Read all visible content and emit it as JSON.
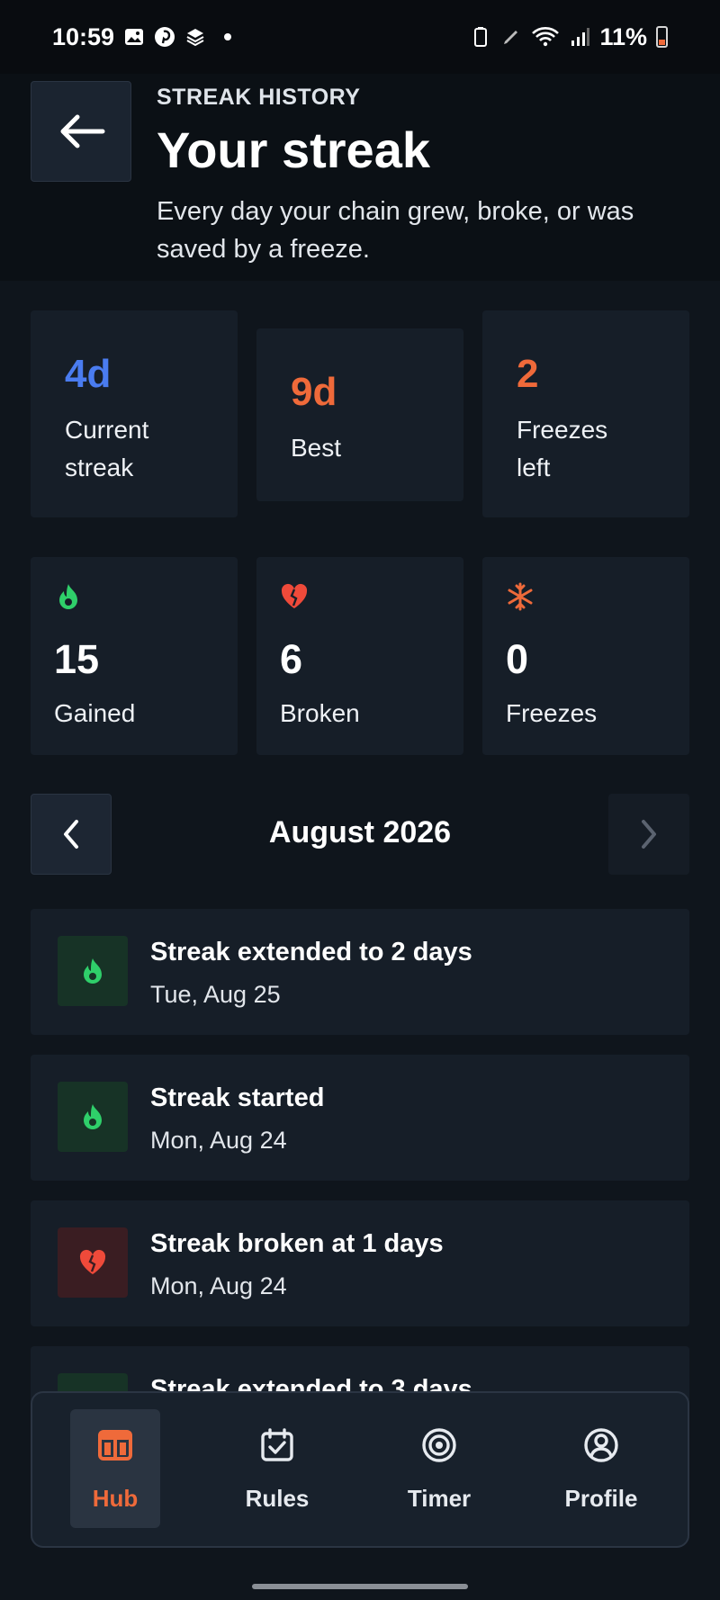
{
  "status_bar": {
    "time": "10:59",
    "battery": "11%"
  },
  "header": {
    "eyebrow": "STREAK HISTORY",
    "title": "Your streak",
    "subtitle": "Every day your chain grew, broke, or was saved by a freeze."
  },
  "stats": [
    {
      "value": "4d",
      "label": "Current streak",
      "color": "#4a7cf0"
    },
    {
      "value": "9d",
      "label": "Best",
      "color": "#ef6a3a"
    },
    {
      "value": "2",
      "label": "Freezes left",
      "color": "#ef6a3a"
    }
  ],
  "counts": [
    {
      "icon": "flame-icon",
      "value": "15",
      "label": "Gained",
      "color": "#2fcf6a"
    },
    {
      "icon": "broken-heart-icon",
      "value": "6",
      "label": "Broken",
      "color": "#ef4a3a"
    },
    {
      "icon": "snowflake-icon",
      "value": "0",
      "label": "Freezes",
      "color": "#ef6a3a"
    }
  ],
  "month_nav": {
    "label": "August 2026"
  },
  "events": [
    {
      "type": "gain",
      "icon": "flame-icon",
      "title": "Streak extended to 2 days",
      "date": "Tue, Aug 25"
    },
    {
      "type": "gain",
      "icon": "flame-icon",
      "title": "Streak started",
      "date": "Mon, Aug 24"
    },
    {
      "type": "broken",
      "icon": "broken-heart-icon",
      "title": "Streak broken at 1 days",
      "date": "Mon, Aug 24"
    },
    {
      "type": "gain",
      "icon": "flame-icon",
      "title": "Streak extended to 3 days",
      "date": ""
    }
  ],
  "tabs": [
    {
      "label": "Hub",
      "icon": "layout-icon",
      "active": true
    },
    {
      "label": "Rules",
      "icon": "calendar-check-icon",
      "active": false
    },
    {
      "label": "Timer",
      "icon": "target-icon",
      "active": false
    },
    {
      "label": "Profile",
      "icon": "user-circle-icon",
      "active": false
    }
  ],
  "colors": {
    "accent_orange": "#ef6a3a",
    "accent_blue": "#4a7cf0",
    "success_green": "#2fcf6a",
    "danger_red": "#ef4a3a",
    "background": "#0f151c",
    "card": "#161e28"
  }
}
